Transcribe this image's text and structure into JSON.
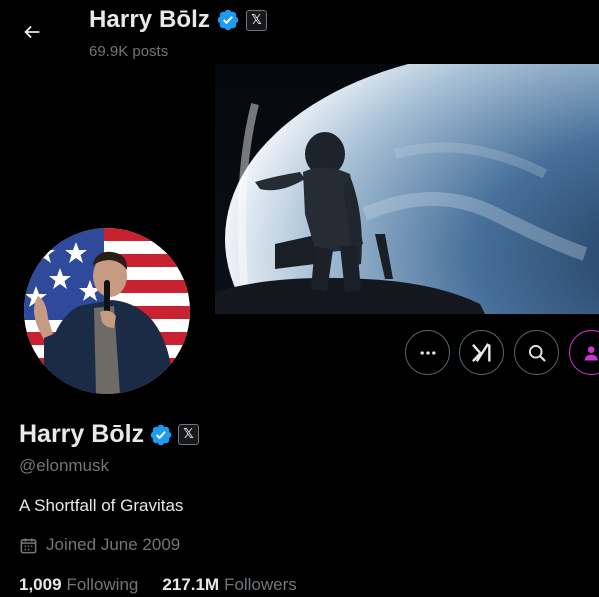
{
  "header": {
    "display_name": "Harry Bōlz",
    "posts_count": "69.9K posts",
    "affiliate_badge_glyph": "𝕏"
  },
  "profile": {
    "display_name": "Harry Bōlz",
    "handle": "@elonmusk",
    "bio": "A Shortfall of Gravitas",
    "joined": "Joined June 2009",
    "following_count": "1,009",
    "following_label": "Following",
    "followers_count": "217.1M",
    "followers_label": "Followers",
    "verified": true
  },
  "actions": [
    {
      "name": "more-options",
      "icon": "ellipsis-icon"
    },
    {
      "name": "grok",
      "icon": "grok-icon"
    },
    {
      "name": "search",
      "icon": "search-icon"
    },
    {
      "name": "subscribe",
      "icon": "subscribe-person-icon"
    }
  ],
  "colors": {
    "background": "#000000",
    "text_primary": "#e7e9ea",
    "text_secondary": "#71767b",
    "verified_blue": "#1d9bf0",
    "button_border": "#536471",
    "subscribe_accent": "#c936cc"
  }
}
